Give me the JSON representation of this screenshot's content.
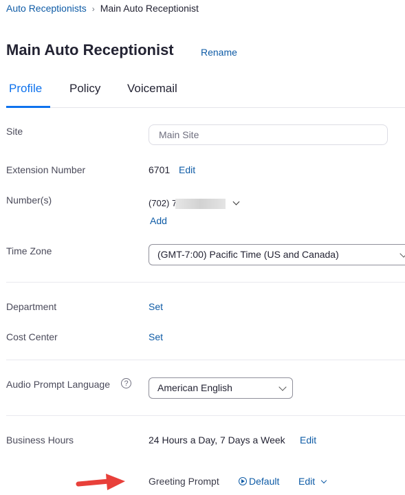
{
  "breadcrumb": {
    "parent": "Auto Receptionists",
    "separator": "›",
    "current": "Main Auto Receptionist"
  },
  "header": {
    "title": "Main Auto Receptionist",
    "rename_label": "Rename"
  },
  "tabs": [
    {
      "label": "Profile",
      "active": true
    },
    {
      "label": "Policy",
      "active": false
    },
    {
      "label": "Voicemail",
      "active": false
    }
  ],
  "profile": {
    "site": {
      "label": "Site",
      "value": "Main Site"
    },
    "extension": {
      "label": "Extension Number",
      "value": "6701",
      "edit_label": "Edit"
    },
    "numbers": {
      "label": "Number(s)",
      "value": "(702) 7",
      "add_label": "Add"
    },
    "time_zone": {
      "label": "Time Zone",
      "value": "(GMT-7:00) Pacific Time (US and Canada)"
    },
    "department": {
      "label": "Department",
      "set_label": "Set"
    },
    "cost_center": {
      "label": "Cost Center",
      "set_label": "Set"
    },
    "audio_prompt_language": {
      "label": "Audio Prompt Language",
      "help_symbol": "?",
      "value": "American English"
    },
    "business_hours": {
      "label": "Business Hours",
      "value": "24 Hours a Day, 7 Days a Week",
      "edit_label": "Edit",
      "greeting_prompt": {
        "label": "Greeting Prompt",
        "value": "Default",
        "edit_label": "Edit"
      }
    }
  },
  "colors": {
    "link": "#0E5BA6",
    "active_tab": "#0E72ED",
    "annotation_arrow": "#E8403A"
  },
  "icons": [
    "breadcrumb-chevron-icon",
    "dropdown-chevron-icon",
    "help-icon",
    "play-icon",
    "annotation-arrow-icon"
  ]
}
